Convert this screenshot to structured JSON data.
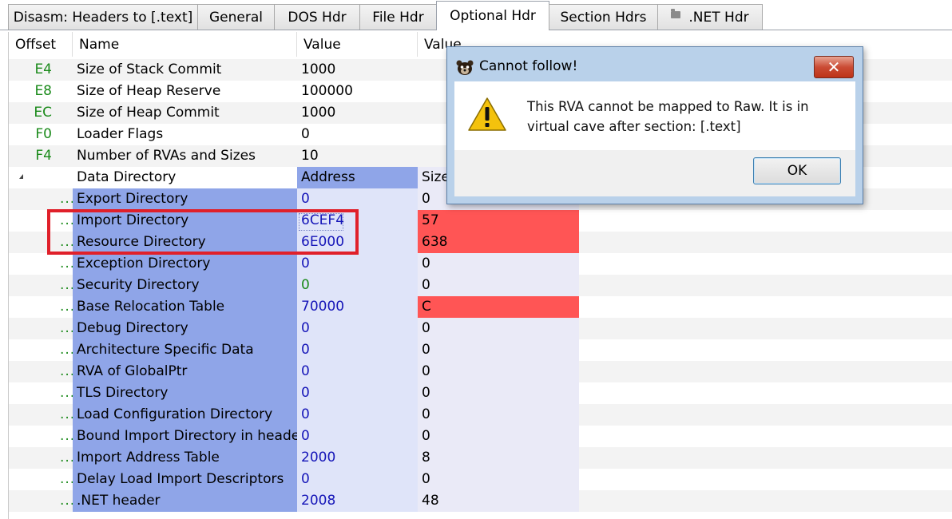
{
  "tabs": [
    {
      "label": "Disasm: Headers to [.text]",
      "active": false
    },
    {
      "label": "General",
      "active": false
    },
    {
      "label": "DOS Hdr",
      "active": false
    },
    {
      "label": "File Hdr",
      "active": false
    },
    {
      "label": "Optional Hdr",
      "active": true
    },
    {
      "label": "Section Hdrs",
      "active": false
    },
    {
      "label": ".NET Hdr",
      "active": false,
      "icon": "folder-icon"
    }
  ],
  "columns": {
    "offset": "Offset",
    "name": "Name",
    "value": "Value",
    "value2": "Value"
  },
  "header_rows": [
    {
      "offset": "E4",
      "name": "Size of Stack Commit",
      "value": "1000"
    },
    {
      "offset": "E8",
      "name": "Size of Heap Reserve",
      "value": "100000"
    },
    {
      "offset": "EC",
      "name": "Size of Heap Commit",
      "value": "1000"
    },
    {
      "offset": "F0",
      "name": "Loader Flags",
      "value": "0"
    },
    {
      "offset": "F4",
      "name": "Number of RVAs and Sizes",
      "value": "10"
    }
  ],
  "data_directory": {
    "label": "Data Directory",
    "address_header": "Address",
    "size_header": "Size",
    "expander": "▲",
    "prefix": "...",
    "entries": [
      {
        "name": "Export Directory",
        "address": "0",
        "size": "0",
        "size_flag": "normal",
        "addr_color": "blue"
      },
      {
        "name": "Import Directory",
        "address": "6CEF4",
        "size": "57",
        "size_flag": "red",
        "addr_color": "blue"
      },
      {
        "name": "Resource Directory",
        "address": "6E000",
        "size": "638",
        "size_flag": "red",
        "addr_color": "blue"
      },
      {
        "name": "Exception Directory",
        "address": "0",
        "size": "0",
        "size_flag": "normal",
        "addr_color": "blue"
      },
      {
        "name": "Security Directory",
        "address": "0",
        "size": "0",
        "size_flag": "normal",
        "addr_color": "green"
      },
      {
        "name": "Base Relocation Table",
        "address": "70000",
        "size": "C",
        "size_flag": "red",
        "addr_color": "blue"
      },
      {
        "name": "Debug Directory",
        "address": "0",
        "size": "0",
        "size_flag": "normal",
        "addr_color": "blue"
      },
      {
        "name": "Architecture Specific Data",
        "address": "0",
        "size": "0",
        "size_flag": "normal",
        "addr_color": "blue"
      },
      {
        "name": "RVA of GlobalPtr",
        "address": "0",
        "size": "0",
        "size_flag": "normal",
        "addr_color": "blue"
      },
      {
        "name": "TLS Directory",
        "address": "0",
        "size": "0",
        "size_flag": "normal",
        "addr_color": "blue"
      },
      {
        "name": "Load Configuration Directory",
        "address": "0",
        "size": "0",
        "size_flag": "normal",
        "addr_color": "blue"
      },
      {
        "name": "Bound Import Directory in headers",
        "address": "0",
        "size": "0",
        "size_flag": "normal",
        "addr_color": "blue"
      },
      {
        "name": "Import Address Table",
        "address": "2000",
        "size": "8",
        "size_flag": "normal",
        "addr_color": "blue"
      },
      {
        "name": "Delay Load Import Descriptors",
        "address": "0",
        "size": "0",
        "size_flag": "normal",
        "addr_color": "blue"
      },
      {
        "name": ".NET header",
        "address": "2008",
        "size": "48",
        "size_flag": "normal",
        "addr_color": "blue"
      }
    ]
  },
  "dialog": {
    "title": "Cannot follow!",
    "message": "This RVA cannot be mapped to Raw. It is in virtual cave after section: [.text]",
    "ok_label": "OK",
    "close_label": "✕",
    "title_icon": "bear-icon",
    "body_icon": "warning-icon"
  },
  "colors": {
    "selection_outline": "#e0202a",
    "name_highlight": "#8fa5e8",
    "size_error": "#ff5555",
    "offset_text": "#1a8a1a",
    "address_text": "#1515b8"
  }
}
